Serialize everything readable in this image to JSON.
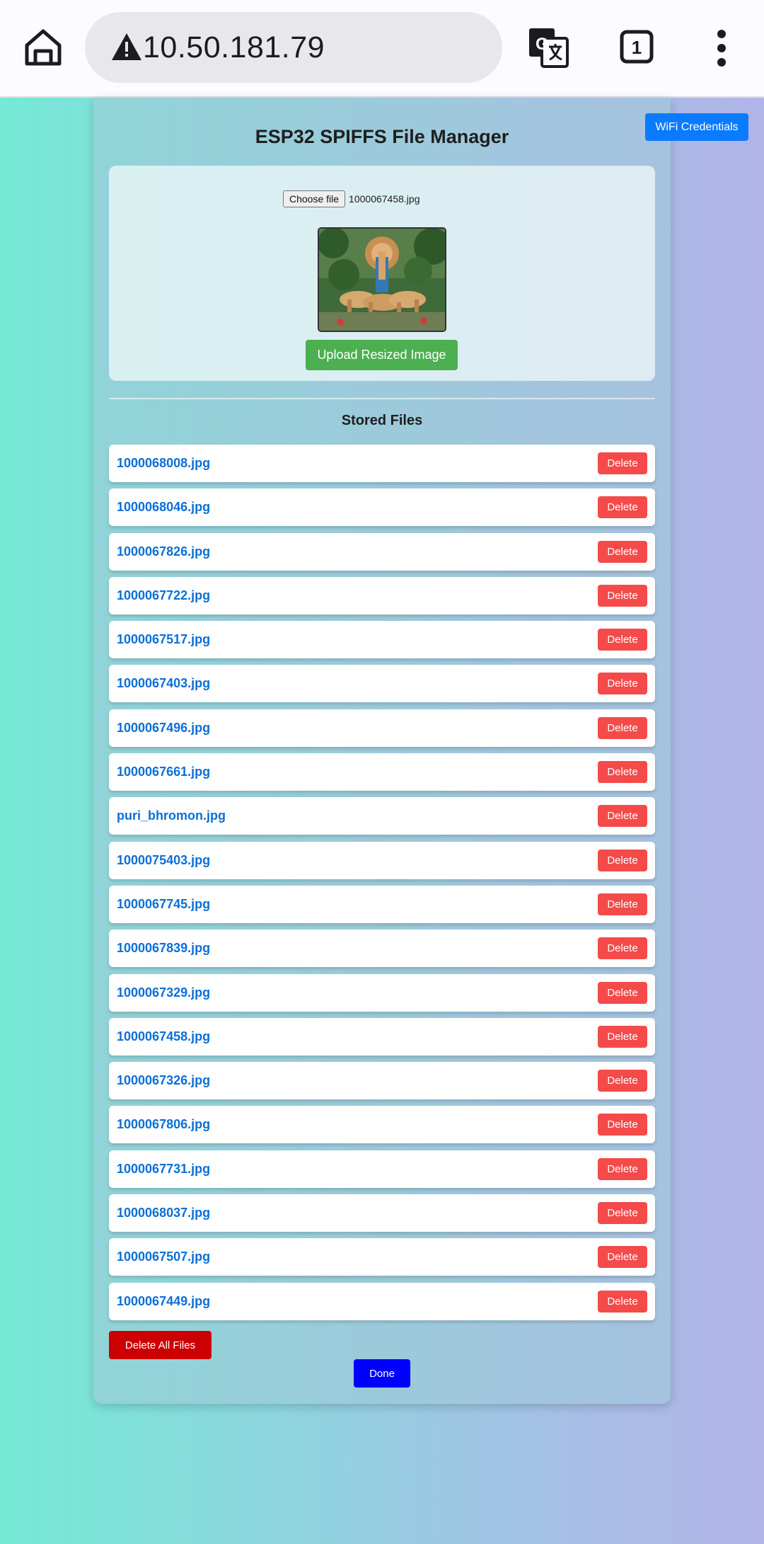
{
  "browser": {
    "url": "10.50.181.79",
    "tab_count": "1"
  },
  "header": {
    "wifi_button_label": "WiFi Credentials",
    "title": "ESP32 SPIFFS File Manager"
  },
  "upload": {
    "choose_file_label": "Choose file",
    "selected_file": "1000067458.jpg",
    "upload_button_label": "Upload Resized Image"
  },
  "stored": {
    "title": "Stored Files",
    "delete_label": "Delete",
    "files": [
      "1000068008.jpg",
      "1000068046.jpg",
      "1000067826.jpg",
      "1000067722.jpg",
      "1000067517.jpg",
      "1000067403.jpg",
      "1000067496.jpg",
      "1000067661.jpg",
      "puri_bhromon.jpg",
      "1000075403.jpg",
      "1000067745.jpg",
      "1000067839.jpg",
      "1000067329.jpg",
      "1000067458.jpg",
      "1000067326.jpg",
      "1000067806.jpg",
      "1000067731.jpg",
      "1000068037.jpg",
      "1000067507.jpg",
      "1000067449.jpg"
    ]
  },
  "footer": {
    "delete_all_label": "Delete All Files",
    "done_label": "Done"
  },
  "colors": {
    "wifi_button": "#0a7bff",
    "upload_button": "#4caf50",
    "delete_button": "#f44a4a",
    "delete_all_button": "#cc0000",
    "done_button": "#0000ff",
    "file_link": "#0a6fd8"
  },
  "icons": [
    "home-icon",
    "warning-icon",
    "translate-icon",
    "tab-switcher-icon",
    "more-vert-icon"
  ]
}
